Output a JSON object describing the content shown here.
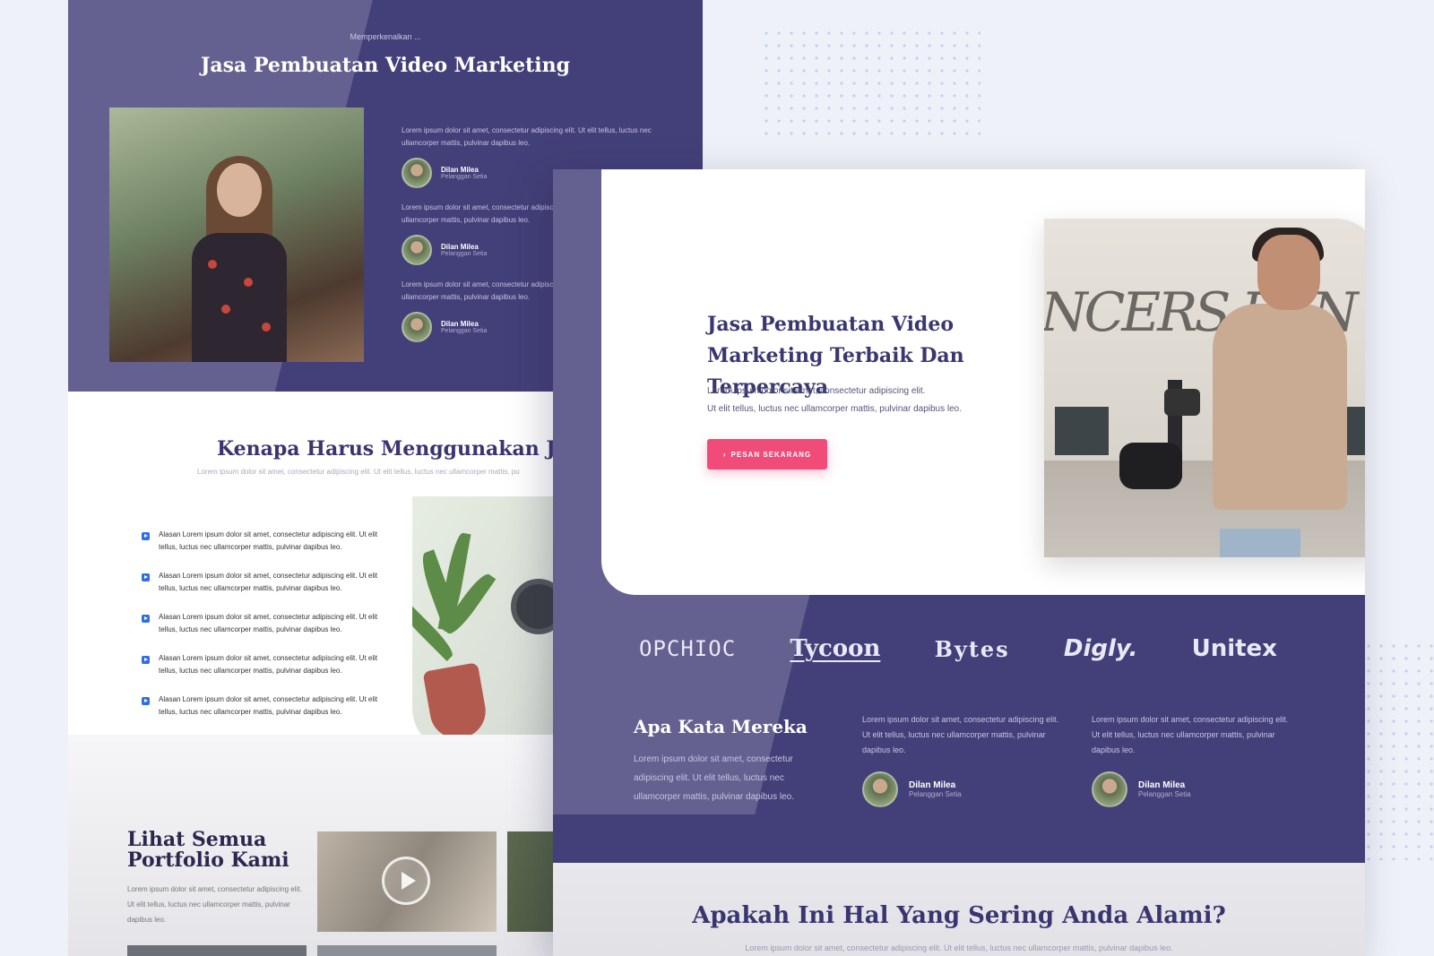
{
  "back": {
    "hero": {
      "eyebrow": "Memperkenalkan ...",
      "title": "Jasa Pembuatan Video Marketing",
      "testimonials": [
        {
          "text": "Lorem ipsum dolor sit amet, consectetur adipiscing elit. Ut elit tellus, luctus nec ullamcorper mattis, pulvinar dapibus leo.",
          "name": "Dilan Milea",
          "role": "Pelanggan Setia"
        },
        {
          "text": "Lorem ipsum dolor sit amet, consectetur adipiscing elit. Ut elit tellus, luctus nec ullamcorper mattis, pulvinar dapibus leo.",
          "name": "Dilan Milea",
          "role": "Pelanggan Setia"
        },
        {
          "text": "Lorem ipsum dolor sit amet, consectetur adipiscing elit. Ut elit tellus, luctus nec ullamcorper mattis, pulvinar dapibus leo.",
          "name": "Dilan Milea",
          "role": "Pelanggan Setia"
        }
      ]
    },
    "why": {
      "title": "Kenapa Harus Menggunakan Jasa Ka",
      "subtitle": "Lorem ipsum dolor sit amet, consectetur adipiscing elit. Ut elit tellus, luctus nec ullamcorper mattis, pu",
      "reasons": [
        "Alasan Lorem ipsum dolor sit amet, consectetur adipiscing elit. Ut elit tellus, luctus nec ullamcorper mattis, pulvinar dapibus leo.",
        "Alasan Lorem ipsum dolor sit amet, consectetur adipiscing elit. Ut elit tellus, luctus nec ullamcorper mattis, pulvinar dapibus leo.",
        "Alasan Lorem ipsum dolor sit amet, consectetur adipiscing elit. Ut elit tellus, luctus nec ullamcorper mattis, pulvinar dapibus leo.",
        "Alasan Lorem ipsum dolor sit amet, consectetur adipiscing elit. Ut elit tellus, luctus nec ullamcorper mattis, pulvinar dapibus leo.",
        "Alasan Lorem ipsum dolor sit amet, consectetur adipiscing elit. Ut elit tellus, luctus nec ullamcorper mattis, pulvinar dapibus leo."
      ]
    },
    "portfolio": {
      "title_line1": "Lihat Semua",
      "title_line2": "Portfolio Kami",
      "desc": "Lorem ipsum dolor sit amet, consectetur adipiscing elit. Ut elit tellus, luctus nec ullamcorper mattis, pulvinar dapibus leo."
    }
  },
  "front": {
    "hero": {
      "title": "Jasa Pembuatan Video Marketing Terbaik Dan Terpercaya",
      "lead_line1": "Lorem ipsum dolor sit amet, consectetur adipiscing elit.",
      "lead_line2": "Ut elit tellus, luctus nec ullamcorper mattis, pulvinar dapibus leo.",
      "cta_label": "PESAN SEKARANG",
      "cta_icon": "chevron-right-icon"
    },
    "logos": [
      "OPCHIOC",
      "Tycoon",
      "Bytes",
      "Digly.",
      "Unitex"
    ],
    "says": {
      "title": "Apa Kata Mereka",
      "desc": "Lorem ipsum dolor sit amet, consectetur adipiscing elit. Ut elit tellus, luctus nec ullamcorper mattis, pulvinar dapibus leo.",
      "testimonials": [
        {
          "text": "Lorem ipsum dolor sit amet, consectetur adipiscing elit. Ut elit tellus, luctus nec ullamcorper mattis, pulvinar dapibus leo.",
          "name": "Dilan Milea",
          "role": "Pelanggan Setia"
        },
        {
          "text": "Lorem ipsum dolor sit amet, consectetur adipiscing elit. Ut elit tellus, luctus nec ullamcorper mattis, pulvinar dapibus leo.",
          "name": "Dilan Milea",
          "role": "Pelanggan Setia"
        }
      ]
    },
    "problem": {
      "title": "Apakah Ini Hal Yang Sering Anda Alami?",
      "subtitle": "Lorem ipsum dolor sit amet, consectetur adipiscing elit. Ut elit tellus, luctus nec ullamcorper mattis, pulvinar dapibus leo."
    }
  },
  "colors": {
    "brand_purple": "#433f78",
    "cta_pink": "#f04b79",
    "check_blue": "#2f6ee8"
  }
}
